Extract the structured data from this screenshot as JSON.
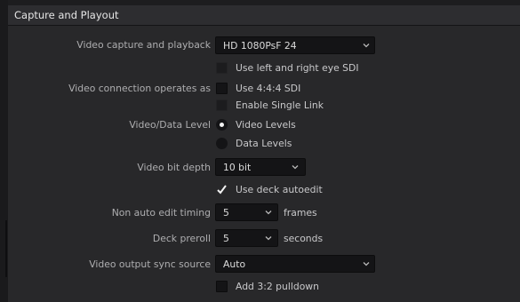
{
  "section": {
    "title": "Capture and Playout"
  },
  "video_capture": {
    "label": "Video capture and playback",
    "value": "HD 1080PsF 24"
  },
  "connection": {
    "label": "Video connection operates as",
    "options": [
      {
        "label": "Use left and right eye SDI",
        "checked": false,
        "enabled": false
      },
      {
        "label": "Use 4:4:4 SDI",
        "checked": false,
        "enabled": true
      },
      {
        "label": "Enable Single Link",
        "checked": false,
        "enabled": false
      }
    ]
  },
  "data_level": {
    "label": "Video/Data Level",
    "options": [
      {
        "label": "Video Levels",
        "selected": true
      },
      {
        "label": "Data Levels",
        "selected": false
      }
    ]
  },
  "bit_depth": {
    "label": "Video bit depth",
    "value": "10 bit"
  },
  "deck_autoedit": {
    "label": "Use deck autoedit",
    "checked": true
  },
  "non_auto_edit": {
    "label": "Non auto edit timing",
    "value": "5",
    "unit": "frames"
  },
  "deck_preroll": {
    "label": "Deck preroll",
    "value": "5",
    "unit": "seconds"
  },
  "sync_source": {
    "label": "Video output sync source",
    "value": "Auto"
  },
  "pulldown": {
    "label": "Add 3:2 pulldown",
    "checked": false
  }
}
